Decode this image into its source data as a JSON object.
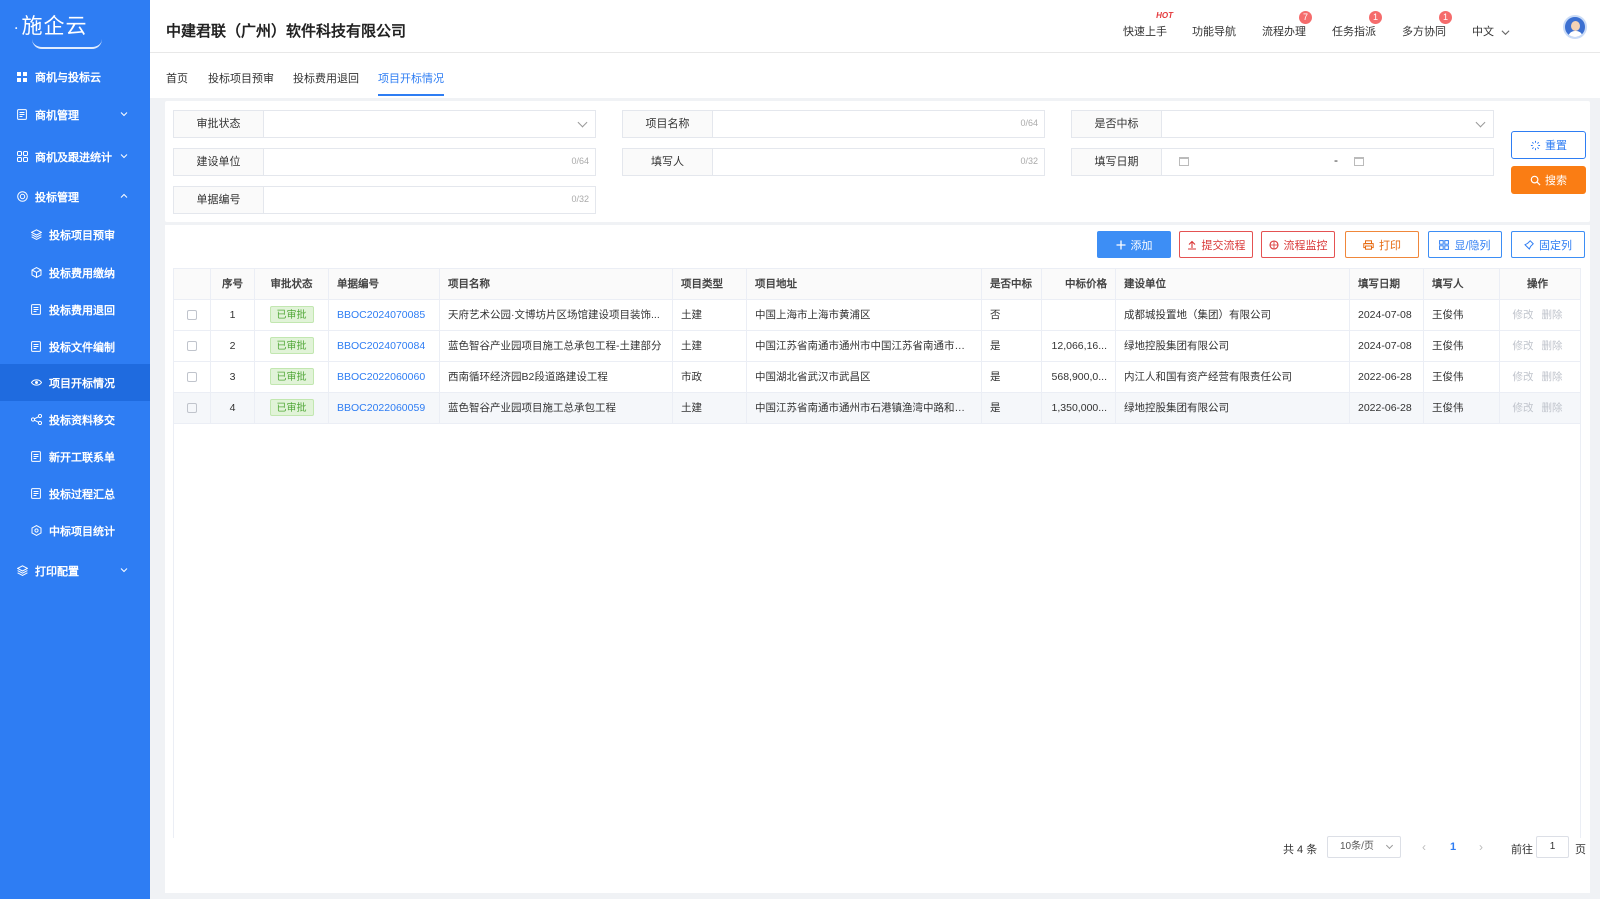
{
  "app": {
    "logo": "施企云",
    "company": "中建君联（广州）软件科技有限公司"
  },
  "colors": {
    "primary": "#2e7df3",
    "sidebar": "#2e7df3",
    "search": "#fa7d14",
    "danger": "#e45252",
    "success": "#52a83a"
  },
  "sidebar": {
    "items": [
      {
        "label": "商机与投标云",
        "icon": "grid-icon",
        "level": 1
      },
      {
        "label": "商机管理",
        "icon": "document-icon",
        "level": 1,
        "chevron": "down"
      },
      {
        "label": "商机及跟进统计",
        "icon": "apps-icon",
        "level": 1,
        "chevron": "down"
      },
      {
        "label": "投标管理",
        "icon": "target-icon",
        "level": 1,
        "chevron": "up"
      },
      {
        "label": "投标项目预审",
        "icon": "layers-icon",
        "level": 2
      },
      {
        "label": "投标费用缴纳",
        "icon": "cube-icon",
        "level": 2
      },
      {
        "label": "投标费用退回",
        "icon": "refund-icon",
        "level": 2
      },
      {
        "label": "投标文件编制",
        "icon": "file-edit-icon",
        "level": 2
      },
      {
        "label": "项目开标情况",
        "icon": "eye-icon",
        "level": 2,
        "active": true
      },
      {
        "label": "投标资料移交",
        "icon": "share-icon",
        "level": 2
      },
      {
        "label": "新开工联系单",
        "icon": "form-icon",
        "level": 2
      },
      {
        "label": "投标过程汇总",
        "icon": "summary-icon",
        "level": 2
      },
      {
        "label": "中标项目统计",
        "icon": "stats-icon",
        "level": 2
      },
      {
        "label": "打印配置",
        "icon": "stack-icon",
        "level": 1,
        "chevron": "down"
      }
    ]
  },
  "header": {
    "items": [
      {
        "label": "快速上手",
        "hot": "HOT"
      },
      {
        "label": "功能导航"
      },
      {
        "label": "流程办理",
        "badge": "7"
      },
      {
        "label": "任务指派",
        "badge": "1"
      },
      {
        "label": "多方协同",
        "badge": "1"
      },
      {
        "label": "中文"
      }
    ]
  },
  "tabs": [
    "首页",
    "投标项目预审",
    "投标费用退回",
    "项目开标情况"
  ],
  "filters": {
    "audit_status": {
      "label": "审批状态"
    },
    "project_name": {
      "label": "项目名称",
      "count": "0/64"
    },
    "is_won": {
      "label": "是否中标"
    },
    "builder": {
      "label": "建设单位",
      "count": "0/64"
    },
    "filler": {
      "label": "填写人",
      "count": "0/32"
    },
    "fill_date": {
      "label": "填写日期",
      "separator": "-"
    },
    "doc_no": {
      "label": "单据编号",
      "count": "0/32"
    },
    "reset": "重置",
    "search": "搜索"
  },
  "toolbar": {
    "add": "添加",
    "submit": "提交流程",
    "monitor": "流程监控",
    "print": "打印",
    "toggle_cols": "显/隐列",
    "fix_cols": "固定列"
  },
  "table": {
    "columns": [
      "序号",
      "审批状态",
      "单据编号",
      "项目名称",
      "项目类型",
      "项目地址",
      "是否中标",
      "中标价格",
      "建设单位",
      "填写日期",
      "填写人",
      "操作"
    ],
    "rows": [
      {
        "no": "1",
        "status": "已审批",
        "doc": "BBOC2024070085",
        "name": "天府艺术公园·文博坊片区场馆建设项目装饰...",
        "type": "土建",
        "addr": "中国上海市上海市黄浦区",
        "won": "否",
        "price": "",
        "builder": "成都城投置地（集团）有限公司",
        "date": "2024-07-08",
        "filler": "王俊伟",
        "edit": "修改",
        "del": "删除"
      },
      {
        "no": "2",
        "status": "已审批",
        "doc": "BBOC2024070084",
        "name": "蓝色智谷产业园项目施工总承包工程-土建部分",
        "type": "土建",
        "addr": "中国江苏省南通市通州市中国江苏省南通市通...",
        "won": "是",
        "price": "12,066,16...",
        "builder": "绿地控股集团有限公司",
        "date": "2024-07-08",
        "filler": "王俊伟",
        "edit": "修改",
        "del": "删除"
      },
      {
        "no": "3",
        "status": "已审批",
        "doc": "BBOC2022060060",
        "name": "西南循环经济园B2段道路建设工程",
        "type": "市政",
        "addr": "中国湖北省武汉市武昌区",
        "won": "是",
        "price": "568,900,0...",
        "builder": "内江人和国有资产经营有限责任公司",
        "date": "2022-06-28",
        "filler": "王俊伟",
        "edit": "修改",
        "del": "删除"
      },
      {
        "no": "4",
        "status": "已审批",
        "doc": "BBOC2022060059",
        "name": "蓝色智谷产业园项目施工总承包工程",
        "type": "土建",
        "addr": "中国江苏省南通市通州市石港镇渔湾中路和秦...",
        "won": "是",
        "price": "1,350,000...",
        "builder": "绿地控股集团有限公司",
        "date": "2022-06-28",
        "filler": "王俊伟",
        "edit": "修改",
        "del": "删除"
      }
    ]
  },
  "pager": {
    "total": "共 4 条",
    "size": "10条/页",
    "current": "1",
    "goto": "前往",
    "goto_value": "1",
    "unit": "页"
  }
}
